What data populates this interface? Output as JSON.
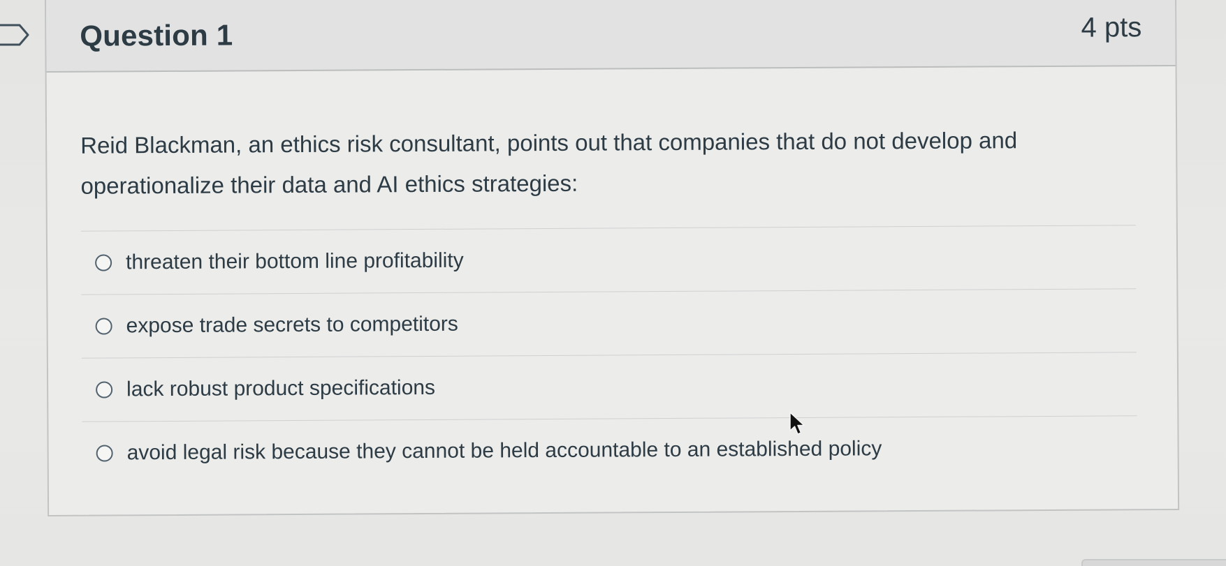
{
  "question": {
    "title": "Question 1",
    "points": "4 pts",
    "text": "Reid Blackman, an ethics risk consultant, points out that companies that do not develop and operationalize their data and AI ethics strategies:"
  },
  "answers": [
    {
      "label": "threaten their bottom line profitability",
      "selected": false
    },
    {
      "label": "expose trade secrets to competitors",
      "selected": false
    },
    {
      "label": "lack robust product specifications",
      "selected": false
    },
    {
      "label": "avoid legal risk because they cannot be held accountable to an established policy",
      "selected": false
    }
  ],
  "colors": {
    "text": "#2d3b45",
    "header_bg": "#e1e2e1",
    "card_bg": "#ececea",
    "border": "#c2c4c4"
  },
  "icons": {
    "flag": "flag-marker-icon",
    "cursor": "mouse-pointer-icon",
    "radio": "radio-button-icon"
  }
}
